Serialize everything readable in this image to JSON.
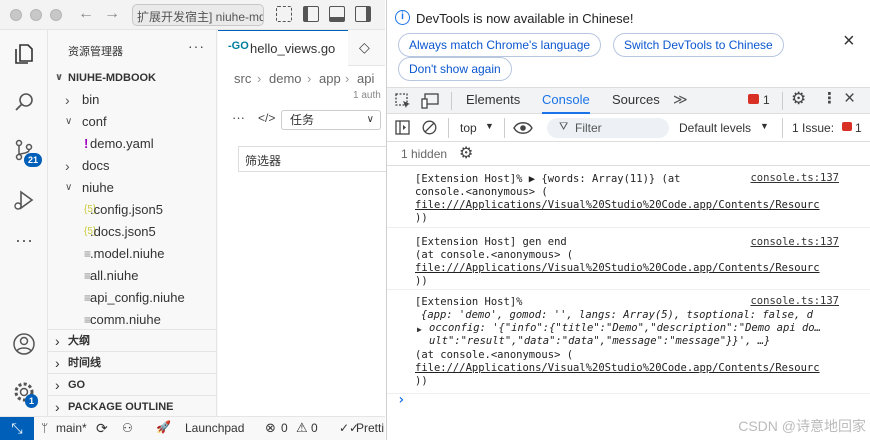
{
  "window": {
    "title": "扩展开发宿主] niuhe-mdbook"
  },
  "activity": {
    "scm_badge": "21",
    "manage_badge": "1"
  },
  "sidebar": {
    "header": "资源管理器",
    "more": "···",
    "root": "NIUHE-MDBOOK",
    "tree": [
      {
        "label": "bin",
        "type": "folder",
        "expanded": false,
        "depth": 1
      },
      {
        "label": "conf",
        "type": "folder",
        "expanded": true,
        "depth": 1
      },
      {
        "label": "demo.yaml",
        "type": "yaml",
        "depth": 2
      },
      {
        "label": "docs",
        "type": "folder",
        "expanded": false,
        "depth": 1
      },
      {
        "label": "niuhe",
        "type": "folder",
        "expanded": true,
        "depth": 1
      },
      {
        "label": ".config.json5",
        "type": "json5",
        "depth": 2
      },
      {
        "label": ".docs.json5",
        "type": "json5",
        "depth": 2
      },
      {
        "label": ".model.niuhe",
        "type": "text",
        "depth": 2
      },
      {
        "label": "all.niuhe",
        "type": "text",
        "depth": 2
      },
      {
        "label": "api_config.niuhe",
        "type": "text",
        "depth": 2
      },
      {
        "label": "comm.niuhe",
        "type": "text",
        "depth": 2
      }
    ],
    "sections": [
      "大纲",
      "时间线",
      "GO",
      "PACKAGE OUTLINE"
    ]
  },
  "editor": {
    "tab": "hello_views.go",
    "breadcrumb": [
      "src",
      "demo",
      "app",
      "api"
    ],
    "auth_hint": "1 auth",
    "task_select": "任务",
    "filter_placeholder": "筛选器"
  },
  "statusbar": {
    "branch": "main*",
    "launchpad": "Launchpad",
    "errors": "0",
    "warnings": "0",
    "prettier": "Pretti"
  },
  "devtools": {
    "info": {
      "message": "DevTools is now available in Chinese!",
      "btn_match": "Always match Chrome's language",
      "btn_switch": "Switch DevTools to Chinese",
      "btn_dont": "Don't show again"
    },
    "tabs": [
      "Elements",
      "Console",
      "Sources"
    ],
    "active_tab": "Console",
    "error_count": "1",
    "context": "top",
    "filter_placeholder": "Filter",
    "levels": "Default levels",
    "issues_label": "1 Issue:",
    "issues_count": "1",
    "hidden": "1 hidden",
    "messages": [
      {
        "source": "console.ts:137",
        "lines": [
          "[Extension Host]%  ▶ {words: Array(11)} (at",
          "console.<anonymous> (",
          "file:///Applications/Visual%20Studio%20Code.app/Contents/Resourc",
          "))"
        ]
      },
      {
        "source": "console.ts:137",
        "lines": [
          "[Extension Host] gen end",
          "(at console.<anonymous> (",
          "file:///Applications/Visual%20Studio%20Code.app/Contents/Resourc",
          "))"
        ]
      },
      {
        "source": "console.ts:137",
        "lines": [
          "[Extension Host]%",
          "{app: 'demo', gomod: '', langs: Array(5), tsoptional: false, d",
          "occonfig: '{\"info\":{\"title\":\"Demo\",\"description\":\"Demo api do…",
          "ult\":\"result\",\"data\":\"data\",\"message\":\"message\"}}', …}",
          "(at console.<anonymous> (",
          "file:///Applications/Visual%20Studio%20Code.app/Contents/Resourc",
          "))"
        ]
      }
    ],
    "prompt": "›"
  },
  "watermark": "CSDN @诗意地回家",
  "colors": {
    "accent": "#005fb8",
    "devtools_blue": "#1a73e8",
    "error": "#d93025"
  }
}
